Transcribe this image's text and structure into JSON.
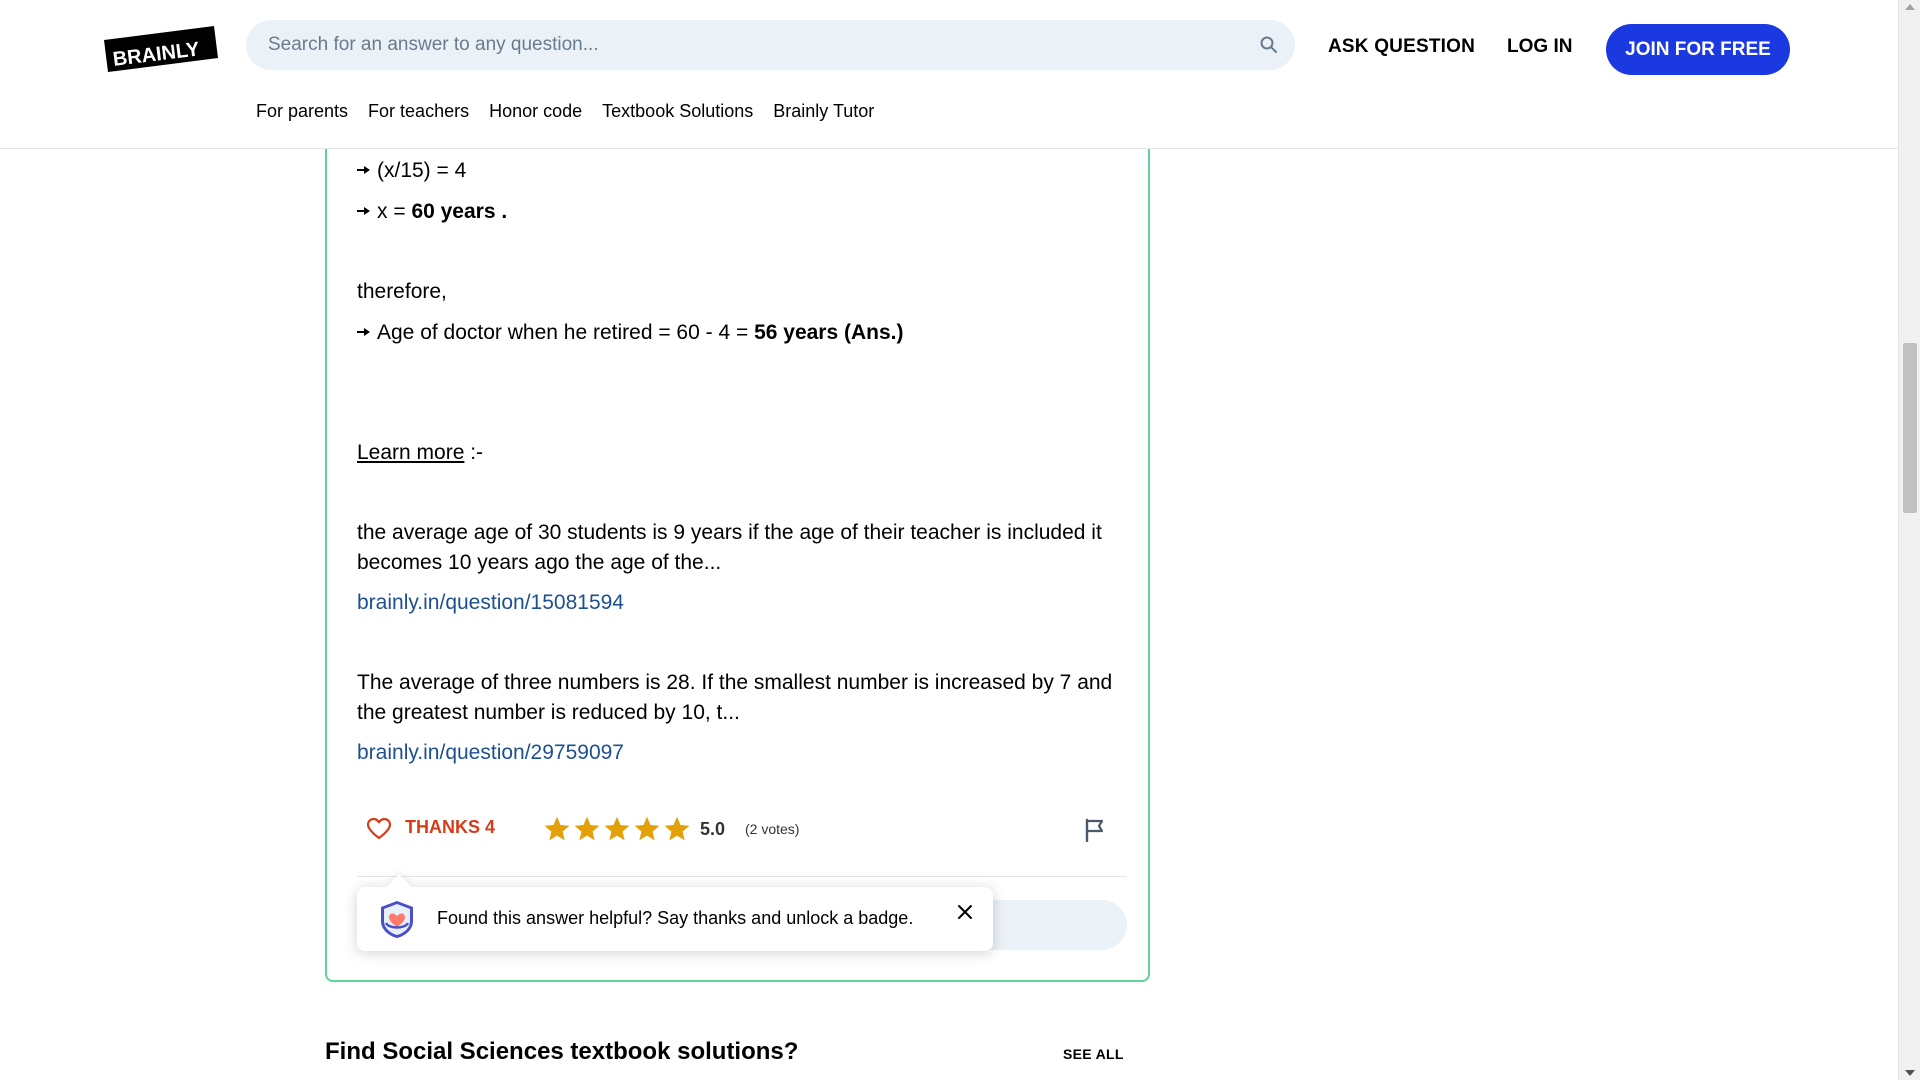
{
  "header": {
    "logo_text": "BRAINLY",
    "search_placeholder": "Search for an answer to any question...",
    "ask_question": "ASK QUESTION",
    "log_in": "LOG IN",
    "join": "JOIN FOR FREE",
    "subnav": [
      "For parents",
      "For teachers",
      "Honor code",
      "Textbook Solutions",
      "Brainly Tutor"
    ]
  },
  "answer": {
    "line1": "(x/15) = 4",
    "line2_prefix": "x = ",
    "line2_bold": "60 years .",
    "therefore": "therefore,",
    "line3_prefix": "Age of doctor when he retired = 60 - 4 = ",
    "line3_bold": "56 years (Ans.)",
    "learn_more": "Learn more",
    "learn_more_suffix": " :-",
    "related": [
      {
        "text": "the average age of 30 students is 9 years if the age of their teacher is included it becomes 10 years ago the age of the...",
        "link": "brainly.in/question/15081594"
      },
      {
        "text": "The average of three numbers is 28. If the smallest number is increased by 7 and the greatest number is reduced by 10, t...",
        "link": "brainly.in/question/29759097"
      }
    ]
  },
  "actions": {
    "thanks": "THANKS 4",
    "rating": "5.0",
    "stars": 5,
    "votes": "(2 votes)"
  },
  "tooltip": {
    "text": "Found this answer helpful? Say thanks and unlock a badge."
  },
  "section": {
    "title": "Find Social Sciences textbook solutions?",
    "see_all": "SEE ALL"
  },
  "colors": {
    "brand_blue": "#1b39e0",
    "card_border": "#60d399",
    "thanks_red": "#d53c1a",
    "star": "#e3a008",
    "link": "#1d4f91"
  }
}
